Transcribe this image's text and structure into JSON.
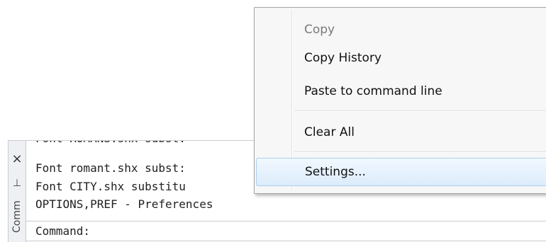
{
  "command_window": {
    "title": "Comm",
    "close_icon": "×",
    "pin_icon": "⊥",
    "history": [
      "Font ROMANS.shx subst:",
      "Font romant.shx subst:",
      "Font CITY.shx substitu",
      "OPTIONS,PREF - Preferences"
    ],
    "prompt": "Command:"
  },
  "context_menu": {
    "items": [
      {
        "label": "Copy",
        "state": "disabled"
      },
      {
        "label": "Copy History",
        "state": "normal"
      },
      {
        "label": "Paste to command line",
        "state": "normal"
      },
      {
        "label": "Clear All",
        "state": "normal"
      },
      {
        "label": "Settings...",
        "state": "highlighted"
      }
    ]
  },
  "colors": {
    "menu_bg": "#f7f7f7",
    "highlight": "#dcecfc",
    "disabled_text": "#7a7a7a"
  }
}
